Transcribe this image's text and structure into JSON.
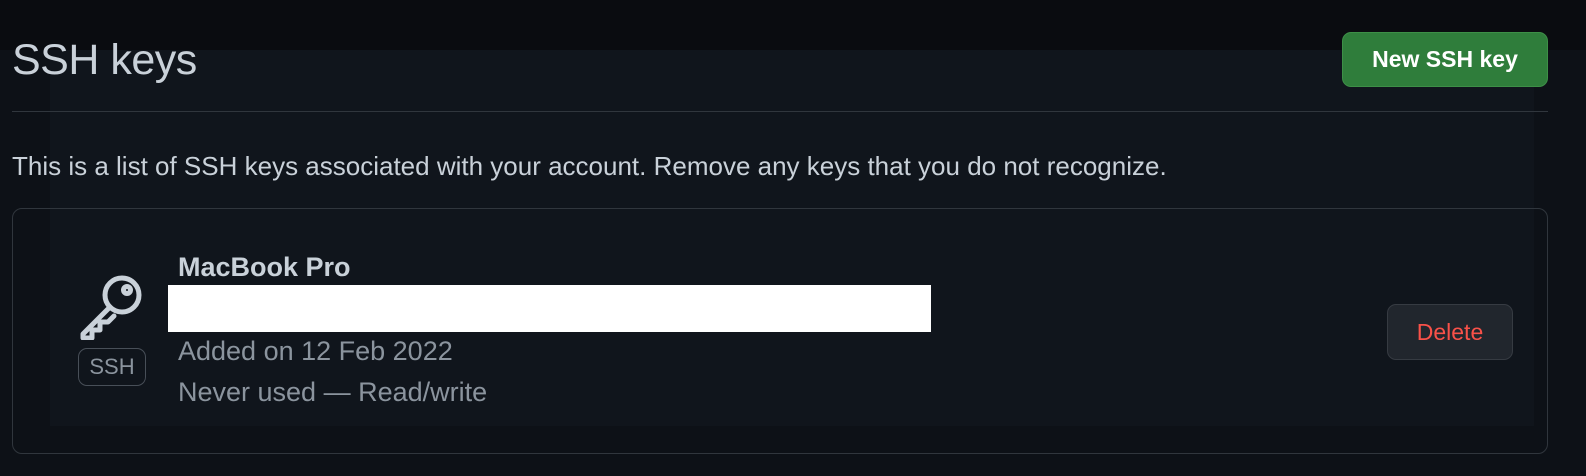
{
  "header": {
    "title": "SSH keys",
    "new_key_label": "New SSH key"
  },
  "description": "This is a list of SSH keys associated with your account. Remove any keys that you do not recognize.",
  "keys": [
    {
      "icon": "key-icon",
      "badge": "SSH",
      "title": "MacBook Pro",
      "added": "Added on 12 Feb 2022",
      "usage": "Never used — Read/write",
      "delete_label": "Delete"
    }
  ],
  "colors": {
    "background": "#0d1117",
    "primary_button": "#2f7d3b",
    "danger_text": "#f85149",
    "border": "#30363d",
    "muted_text": "#8b949e"
  }
}
